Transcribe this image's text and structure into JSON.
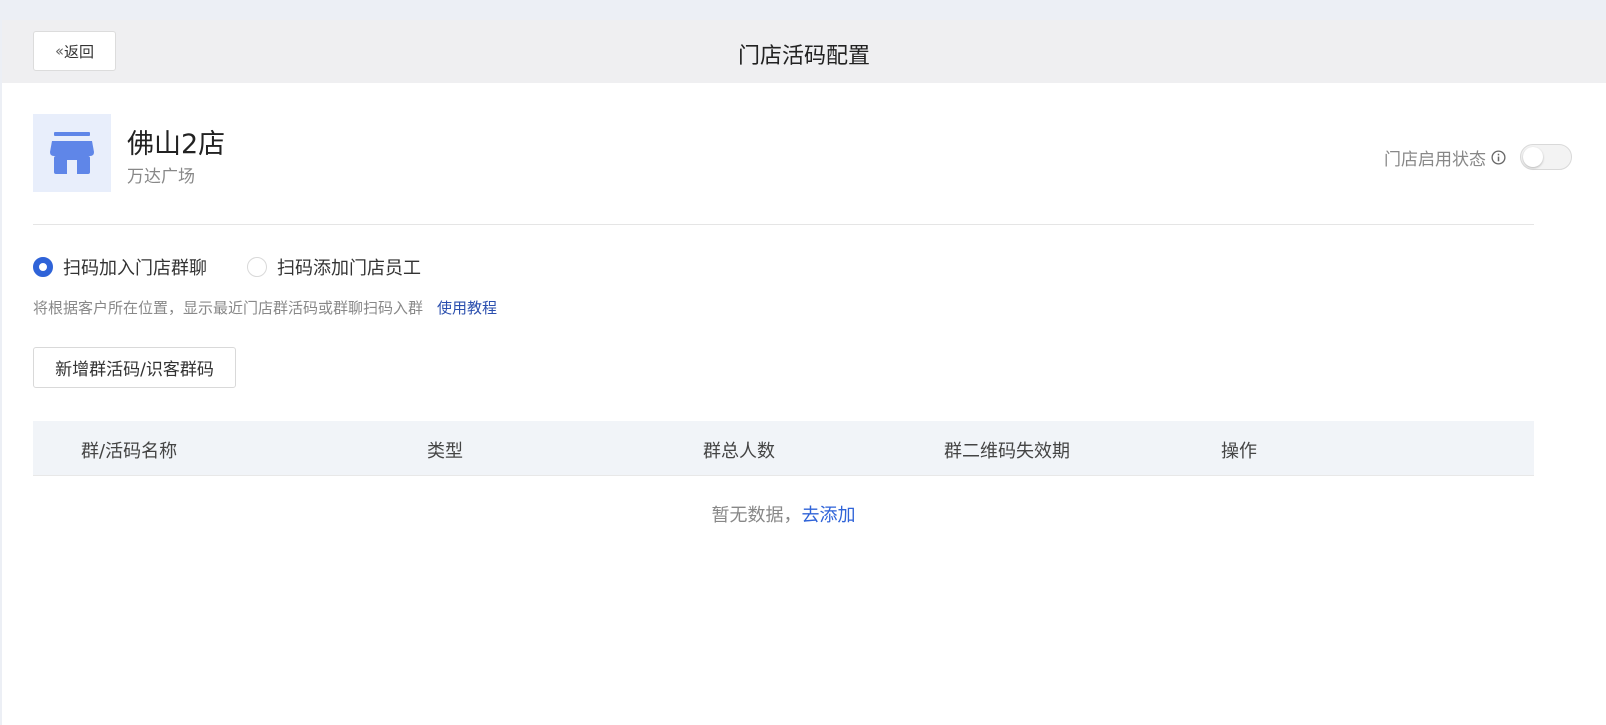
{
  "header": {
    "back_label": "返回",
    "title": "门店活码配置"
  },
  "store": {
    "name": "佛山2店",
    "address": "万达广场",
    "status_label": "门店启用状态",
    "enabled": false
  },
  "mode": {
    "options": [
      {
        "label": "扫码加入门店群聊",
        "checked": true
      },
      {
        "label": "扫码添加门店员工",
        "checked": false
      }
    ],
    "hint": "将根据客户所在位置，显示最近门店群活码或群聊扫码入群",
    "tutorial_link": "使用教程"
  },
  "add_button": "新增群活码/识客群码",
  "table": {
    "columns": [
      "群/活码名称",
      "类型",
      "群总人数",
      "群二维码失效期",
      "操作"
    ],
    "empty_text": "暂无数据，",
    "empty_link": "去添加"
  },
  "colors": {
    "accent": "#2f63d8",
    "link_dark": "#2b4fae",
    "store_icon": "#5f86e8",
    "store_icon_bg": "#e8eefb",
    "header_bg": "#efeff1",
    "table_header_bg": "#f1f4f8"
  }
}
